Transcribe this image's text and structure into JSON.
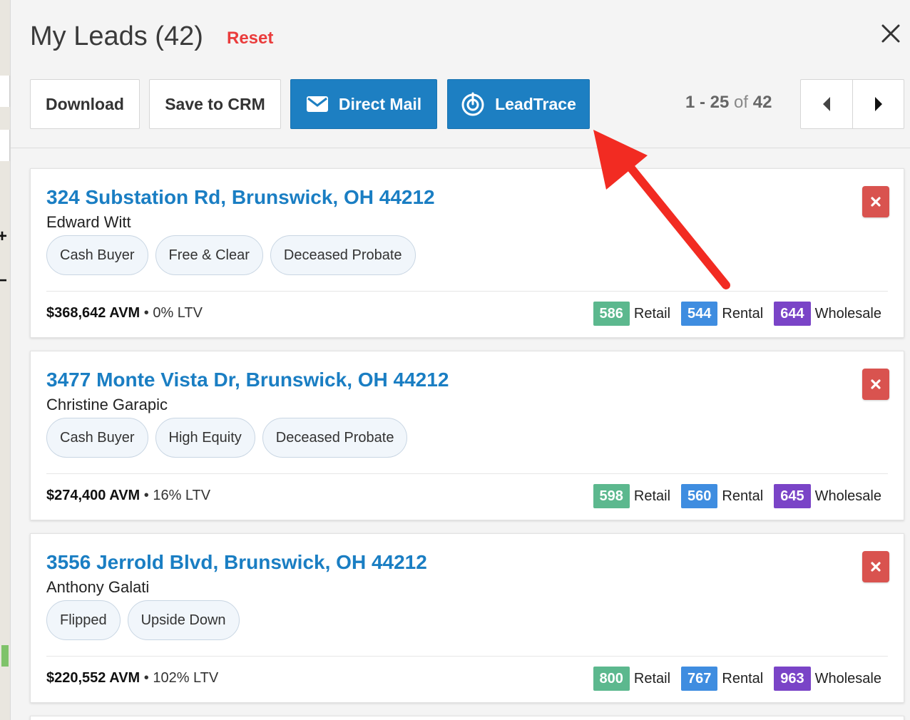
{
  "header": {
    "title": "My Leads (42)",
    "reset_label": "Reset"
  },
  "toolbar": {
    "download_label": "Download",
    "save_crm_label": "Save to CRM",
    "direct_mail_label": "Direct Mail",
    "leadtrace_label": "LeadTrace"
  },
  "pagination": {
    "range": "1 - 25",
    "of": "of",
    "total": "42"
  },
  "leads": [
    {
      "address": "324 Substation Rd, Brunswick, OH 44212",
      "owner": "Edward Witt",
      "tags": [
        "Cash Buyer",
        "Free & Clear",
        "Deceased Probate"
      ],
      "avm": "$368,642 AVM",
      "ltv": "0% LTV",
      "scores": {
        "retail": "586",
        "rental": "544",
        "wholesale": "644"
      }
    },
    {
      "address": "3477 Monte Vista Dr, Brunswick, OH 44212",
      "owner": "Christine Garapic",
      "tags": [
        "Cash Buyer",
        "High Equity",
        "Deceased Probate"
      ],
      "avm": "$274,400 AVM",
      "ltv": "16% LTV",
      "scores": {
        "retail": "598",
        "rental": "560",
        "wholesale": "645"
      }
    },
    {
      "address": "3556 Jerrold Blvd, Brunswick, OH 44212",
      "owner": "Anthony Galati",
      "tags": [
        "Flipped",
        "Upside Down"
      ],
      "avm": "$220,552 AVM",
      "ltv": "102% LTV",
      "scores": {
        "retail": "800",
        "rental": "767",
        "wholesale": "963"
      }
    }
  ],
  "score_labels": {
    "retail": "Retail",
    "rental": "Rental",
    "wholesale": "Wholesale"
  },
  "colors": {
    "accent_blue": "#1d7fc2",
    "reset_red": "#ea3c3c",
    "delete_red": "#d9534f",
    "retail_green": "#5cb88e",
    "rental_blue": "#3f8de0",
    "wholesale_purple": "#7a44c7",
    "annotation_arrow": "#f22b22"
  },
  "icons": {
    "close": "close-icon",
    "direct_mail": "envelope-icon",
    "leadtrace": "target-icon",
    "prev": "caret-left-icon",
    "next": "caret-right-icon",
    "delete": "x-icon"
  }
}
